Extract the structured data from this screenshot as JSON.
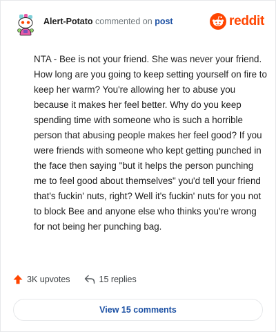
{
  "header": {
    "username": "Alert-Potato",
    "action_text": "commented on",
    "post_link": "post",
    "brand_wordmark": "reddit"
  },
  "comment": {
    "text": "NTA - Bee is not your friend. She was never your friend. How long are you going to keep setting yourself on fire to keep her warm? You're allowing her to abuse you because it makes her feel better. Why do you keep spending time with someone who is such a horrible person that abusing people makes her feel good? If you were friends with someone who kept getting punched in the face then saying \"but it helps the person punching me to feel good about themselves\" you'd tell your friend that's fuckin' nuts, right? Well it's fuckin' nuts for you not to block Bee and anyone else who thinks you're wrong for not being her punching bag."
  },
  "stats": {
    "upvotes": "3K upvotes",
    "replies": "15 replies"
  },
  "footer": {
    "view_comments": "View 15 comments"
  },
  "colors": {
    "brand": "#ff4500",
    "link": "#1a4fa3",
    "meta_gray": "#6f777b",
    "border": "#e6e8ea"
  },
  "icons": {
    "avatar": "snoo-avatar",
    "brand": "reddit-snoo-icon",
    "upvote": "upvote-arrow-icon",
    "reply": "reply-arrow-icon"
  }
}
